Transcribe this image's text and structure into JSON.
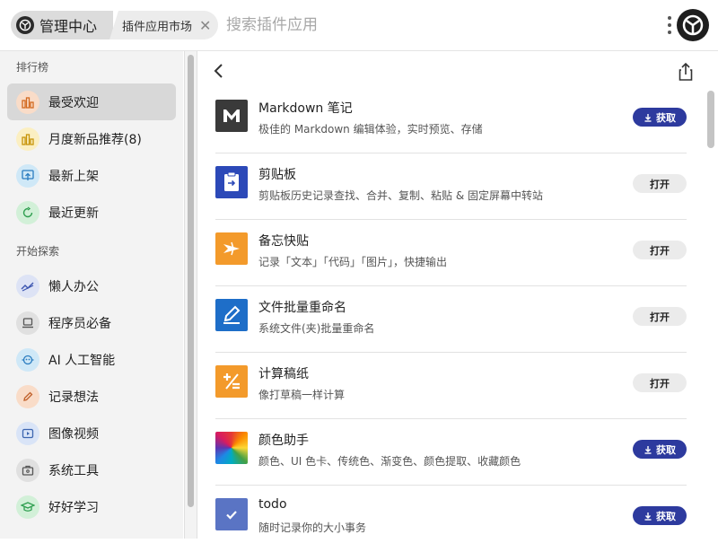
{
  "header": {
    "home_title": "管理中心",
    "tab_label": "插件应用市场",
    "close_glyph": "✕",
    "search_placeholder": "搜索插件应用"
  },
  "sidebar": {
    "section1": "排行榜",
    "ranking": [
      {
        "label": "最受欢迎",
        "icon": "bar-chart-icon",
        "color": "#f9dcc8"
      },
      {
        "label": "月度新品推荐(8)",
        "icon": "bar-chart-icon",
        "color": "#fbefc2"
      },
      {
        "label": "最新上架",
        "icon": "upload-icon",
        "color": "#cfe8f7"
      },
      {
        "label": "最近更新",
        "icon": "refresh-icon",
        "color": "#d2f0d8"
      }
    ],
    "section2": "开始探索",
    "explore": [
      {
        "label": "懒人办公",
        "icon": "office-icon",
        "color": "#dde3f5"
      },
      {
        "label": "程序员必备",
        "icon": "laptop-icon",
        "color": "#e0e0e0"
      },
      {
        "label": "AI 人工智能",
        "icon": "ai-icon",
        "color": "#cfe8f7"
      },
      {
        "label": "记录想法",
        "icon": "pencil-icon",
        "color": "#f9dcc8"
      },
      {
        "label": "图像视频",
        "icon": "video-icon",
        "color": "#d9e4f7"
      },
      {
        "label": "系统工具",
        "icon": "toolbox-icon",
        "color": "#e0e0e0"
      },
      {
        "label": "好好学习",
        "icon": "graduation-icon",
        "color": "#d2f0d8"
      }
    ]
  },
  "plugins": [
    {
      "name": "Markdown 笔记",
      "desc": "极佳的 Markdown 编辑体验，实时预览、存储",
      "action": "获取",
      "type": "get"
    },
    {
      "name": "剪贴板",
      "desc": "剪贴板历史记录查找、合并、复制、粘贴 & 固定屏幕中转站",
      "action": "打开",
      "type": "open"
    },
    {
      "name": "备忘快贴",
      "desc": "记录「文本」「代码」「图片」，快捷输出",
      "action": "打开",
      "type": "open"
    },
    {
      "name": "文件批量重命名",
      "desc": "系统文件(夹)批量重命名",
      "action": "打开",
      "type": "open"
    },
    {
      "name": "计算稿纸",
      "desc": "像打草稿一样计算",
      "action": "打开",
      "type": "open"
    },
    {
      "name": "颜色助手",
      "desc": "颜色、UI 色卡、传统色、渐变色、颜色提取、收藏颜色",
      "action": "获取",
      "type": "get"
    },
    {
      "name": "todo",
      "desc": "随时记录你的大小事务",
      "action": "获取",
      "type": "get"
    }
  ],
  "colors": {
    "accent": "#2d3a9e",
    "sidebar_bg": "#f3f3f3",
    "active_item": "#d8d8d8"
  }
}
